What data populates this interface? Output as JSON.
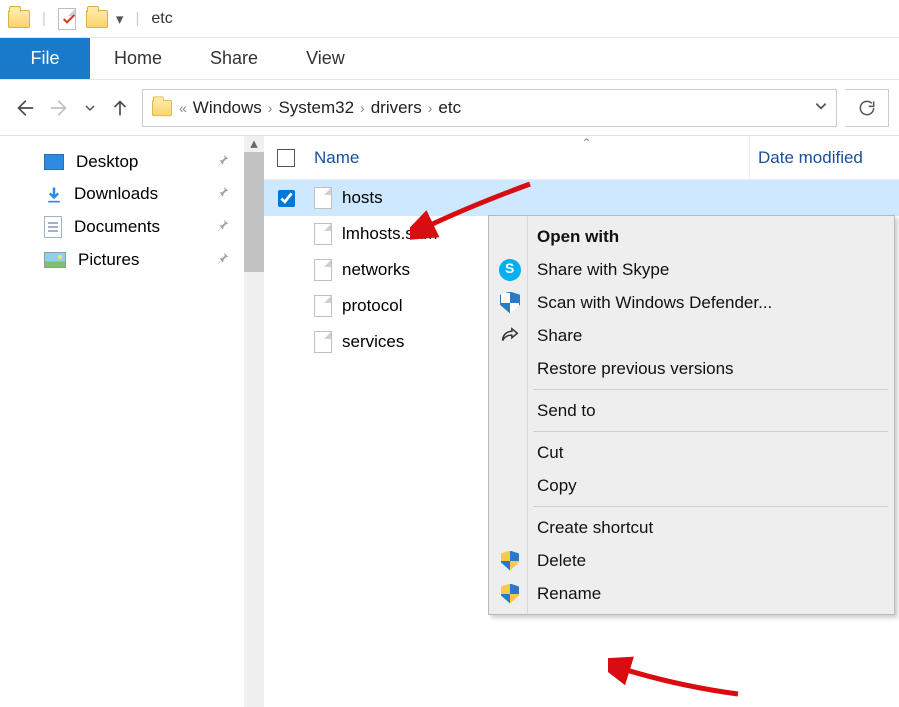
{
  "titlebar": {
    "window_title": "etc"
  },
  "ribbon": {
    "file": "File",
    "tabs": [
      "Home",
      "Share",
      "View"
    ]
  },
  "nav": {
    "breadcrumbs": [
      "Windows",
      "System32",
      "drivers",
      "etc"
    ]
  },
  "sidebar": {
    "items": [
      {
        "label": "Desktop"
      },
      {
        "label": "Downloads"
      },
      {
        "label": "Documents"
      },
      {
        "label": "Pictures"
      }
    ]
  },
  "columns": {
    "name": "Name",
    "date": "Date modified"
  },
  "files": [
    {
      "name": "hosts",
      "selected": true
    },
    {
      "name": "lmhosts.sam",
      "selected": false
    },
    {
      "name": "networks",
      "selected": false
    },
    {
      "name": "protocol",
      "selected": false
    },
    {
      "name": "services",
      "selected": false
    }
  ],
  "context_menu": {
    "open_with": "Open with",
    "share_skype": "Share with Skype",
    "scan_defender": "Scan with Windows Defender...",
    "share": "Share",
    "restore": "Restore previous versions",
    "send_to": "Send to",
    "cut": "Cut",
    "copy": "Copy",
    "create_shortcut": "Create shortcut",
    "delete": "Delete",
    "rename": "Rename"
  }
}
